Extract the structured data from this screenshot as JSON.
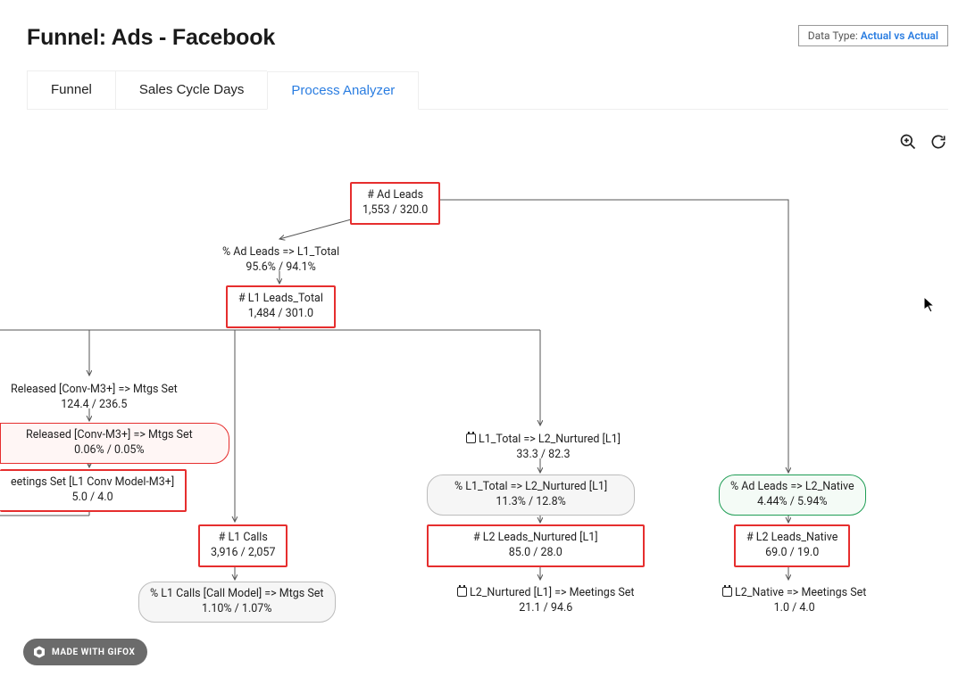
{
  "header": {
    "title": "Funnel: Ads - Facebook",
    "data_type_label": "Data Type:",
    "data_type_value": "Actual vs Actual"
  },
  "tabs": {
    "funnel": "Funnel",
    "sales_cycle": "Sales Cycle Days",
    "process_analyzer": "Process Analyzer"
  },
  "toolbar": {
    "zoom_in": "Zoom In",
    "reset": "Reset"
  },
  "nodes": {
    "ad_leads": {
      "label": "# Ad Leads",
      "value": "1,553 / 320.0"
    },
    "pct_ad_l1": {
      "label": "% Ad Leads => L1_Total",
      "value": "95.6% / 94.1%"
    },
    "l1_total": {
      "label": "# L1 Leads_Total",
      "value": "1,484 / 301.0"
    },
    "released_count": {
      "label": "Released [Conv-M3+] => Mtgs Set",
      "value": "124.4 / 236.5"
    },
    "released_pct": {
      "label": "Released [Conv-M3+] => Mtgs Set",
      "value": "0.06% / 0.05%"
    },
    "meetings_set_model": {
      "label": "eetings Set [L1 Conv Model-M3+]",
      "value": "5.0 / 4.0"
    },
    "l1_calls": {
      "label": "# L1 Calls",
      "value": "3,916 / 2,057"
    },
    "l1_calls_pct": {
      "label": "% L1 Calls [Call Model] => Mtgs Set",
      "value": "1.10% / 1.07%"
    },
    "l1_to_l2_nurtured_days": {
      "label": "L1_Total => L2_Nurtured [L1]",
      "value": "33.3 / 82.3"
    },
    "l1_to_l2_nurtured_pct": {
      "label": "% L1_Total => L2_Nurtured [L1]",
      "value": "11.3% / 12.8%"
    },
    "l2_nurtured": {
      "label": "# L2 Leads_Nurtured [L1]",
      "value": "85.0 / 28.0"
    },
    "l2_nurtured_mtgs": {
      "label": "L2_Nurtured [L1] => Meetings Set",
      "value": "21.1 / 94.6"
    },
    "ad_to_l2_native_pct": {
      "label": "% Ad Leads => L2_Native",
      "value": "4.44% / 5.94%"
    },
    "l2_native": {
      "label": "# L2 Leads_Native",
      "value": "69.0 / 19.0"
    },
    "l2_native_mtgs": {
      "label": "L2_Native => Meetings Set",
      "value": "1.0 / 4.0"
    }
  },
  "footer": {
    "gifox": "MADE WITH GIFOX"
  }
}
